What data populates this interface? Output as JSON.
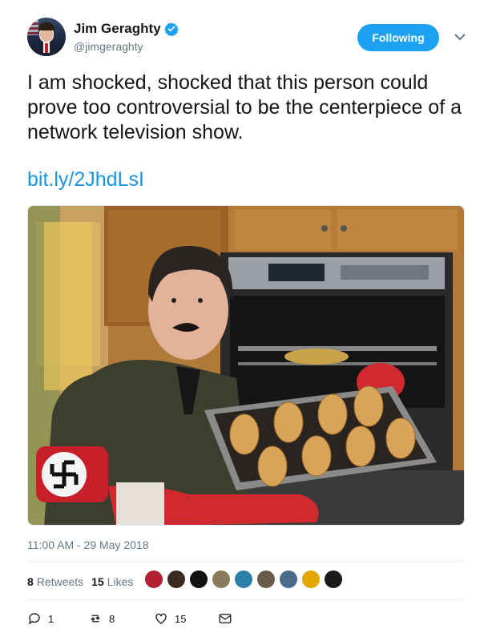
{
  "author": {
    "display_name": "Jim Geraghty",
    "handle": "@jimgeraghty",
    "verified": true
  },
  "follow_button_label": "Following",
  "tweet": {
    "text": "I am shocked, shocked that this person could prove too controversial to be the centerpiece of a network television show.",
    "link": "bit.ly/2JhdLsI"
  },
  "timestamp": "11:00 AM - 29 May 2018",
  "stats": {
    "retweets_count": "8",
    "retweets_label": "Retweets",
    "likes_count": "15",
    "likes_label": "Likes"
  },
  "liker_avatars": [
    {
      "color": "#b22234"
    },
    {
      "color": "#3b2a22"
    },
    {
      "color": "#111111"
    },
    {
      "color": "#8a7a5a"
    },
    {
      "color": "#2e7fa8"
    },
    {
      "color": "#6a5a4a"
    },
    {
      "color": "#4a6a8a"
    },
    {
      "color": "#e2a800"
    },
    {
      "color": "#1a1a1a"
    }
  ],
  "actions": {
    "reply_count": "1",
    "retweet_count": "8",
    "like_count": "15"
  },
  "colors": {
    "accent": "#1da1f2",
    "link": "#1b95e0",
    "muted": "#657786"
  }
}
